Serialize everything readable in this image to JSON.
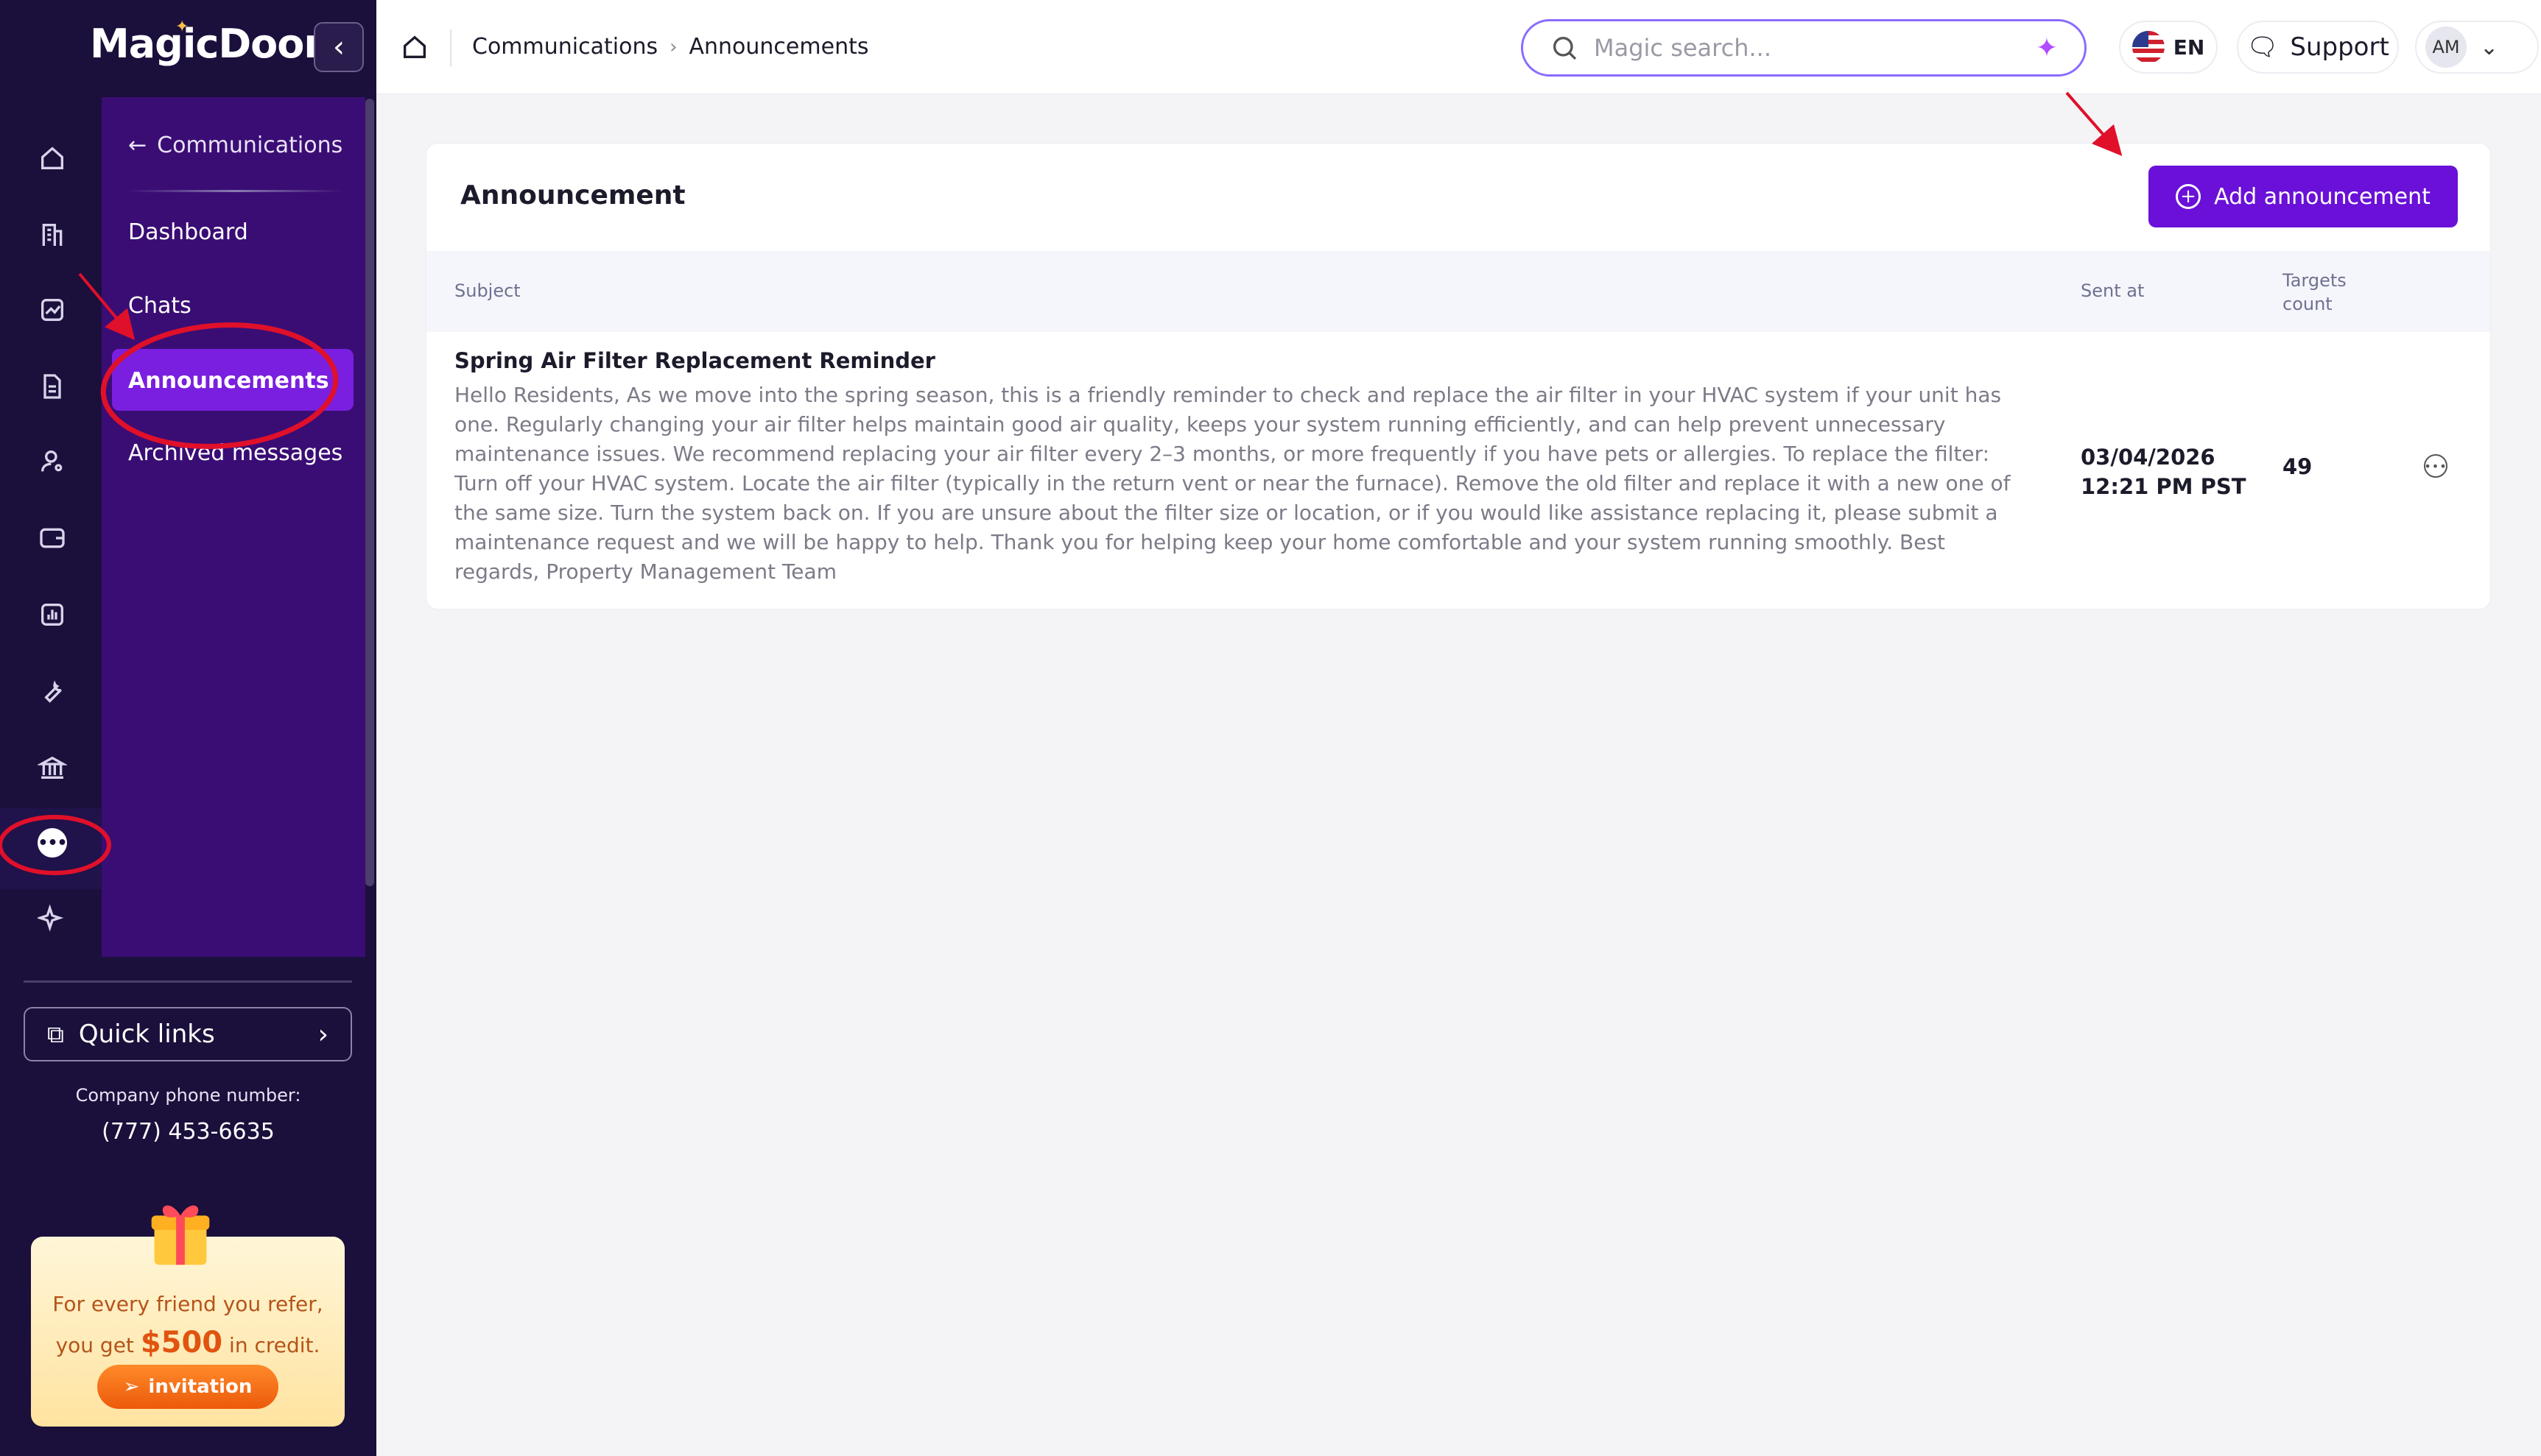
{
  "app": {
    "logo": "MagicDoor"
  },
  "sidebar": {
    "rail_icons": [
      "home-icon",
      "building-icon",
      "chart-icon",
      "document-icon",
      "user-key-icon",
      "wallet-icon",
      "report-icon",
      "wrench-icon",
      "bank-icon",
      "chat-icon",
      "sparkle-icon"
    ],
    "subnav": {
      "back_label": "Communications",
      "items": [
        {
          "label": "Dashboard"
        },
        {
          "label": "Chats"
        },
        {
          "label": "Announcements"
        },
        {
          "label": "Archived messages"
        }
      ]
    },
    "quick_links_label": "Quick links",
    "phone_label": "Company phone number:",
    "phone_number": "(777) 453-6635",
    "promo": {
      "line1": "For every friend you refer,",
      "line2_prefix": "you get",
      "amount": "$500",
      "line2_suffix": "in credit.",
      "button_label": "invitation"
    }
  },
  "topbar": {
    "breadcrumb": [
      "Communications",
      "Announcements"
    ],
    "search_placeholder": "Magic search...",
    "language": "EN",
    "support_label": "Support",
    "user_initials": "AM"
  },
  "main": {
    "card_title": "Announcement",
    "add_button_label": "Add announcement",
    "table": {
      "columns": [
        "Subject",
        "Sent at",
        "Targets count"
      ],
      "columns_targets_line1": "Targets",
      "columns_targets_line2": "count",
      "rows": [
        {
          "subject": "Spring Air Filter Replacement Reminder",
          "body": "Hello Residents, As we move into the spring season, this is a friendly reminder to check and replace the air filter in your HVAC system if your unit has one. Regularly changing your air filter helps maintain good air quality, keeps your system running efficiently, and can help prevent unnecessary maintenance issues. We recommend replacing your air filter every 2–3 months, or more frequently if you have pets or allergies. To replace the filter: Turn off your HVAC system. Locate the air filter (typically in the return vent or near the furnace). Remove the old filter and replace it with a new one of the same size. Turn the system back on. If you are unsure about the filter size or location, or if you would like assistance replacing it, please submit a maintenance request and we will be happy to help. Thank you for helping keep your home comfortable and your system running smoothly. Best regards, Property Management Team",
          "sent_date": "03/04/2026",
          "sent_time": "12:21 PM PST",
          "targets_count": "49"
        }
      ]
    }
  },
  "colors": {
    "sidebar_bg": "#1b0f3b",
    "subnav_bg": "#3a0d74",
    "accent": "#6a10d8",
    "annotation": "#e0102a"
  }
}
